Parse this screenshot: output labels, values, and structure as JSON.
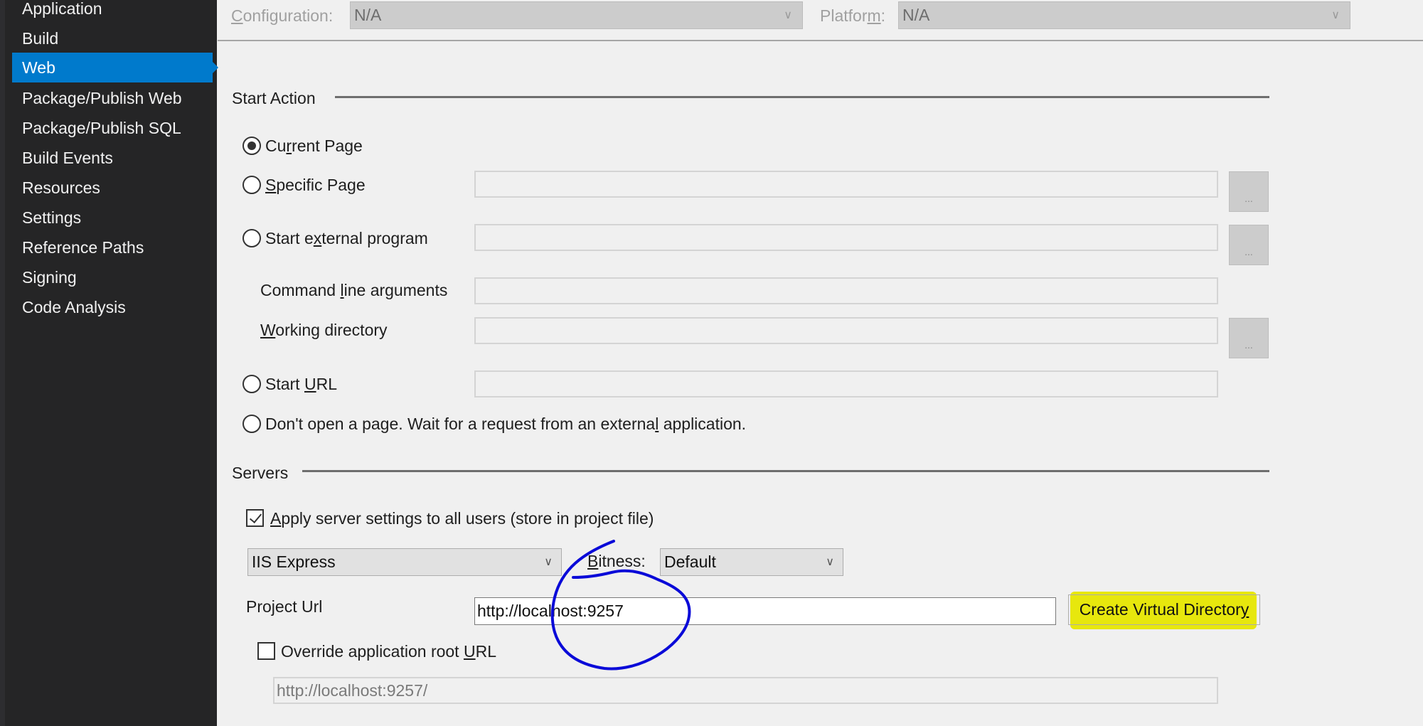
{
  "sidebar": {
    "items": [
      {
        "label": "Application",
        "active": false
      },
      {
        "label": "Build",
        "active": false
      },
      {
        "label": "Web",
        "active": true
      },
      {
        "label": "Package/Publish Web",
        "active": false
      },
      {
        "label": "Package/Publish SQL",
        "active": false
      },
      {
        "label": "Build Events",
        "active": false
      },
      {
        "label": "Resources",
        "active": false
      },
      {
        "label": "Settings",
        "active": false
      },
      {
        "label": "Reference Paths",
        "active": false
      },
      {
        "label": "Signing",
        "active": false
      },
      {
        "label": "Code Analysis",
        "active": false
      }
    ]
  },
  "config_bar": {
    "configuration_label_pre": "",
    "configuration_label_accel": "C",
    "configuration_label_post": "onfiguration:",
    "configuration_value": "N/A",
    "platform_label_pre": "Platfor",
    "platform_label_accel": "m",
    "platform_label_post": ":",
    "platform_value": "N/A"
  },
  "start_action": {
    "title": "Start Action",
    "options": {
      "current_page": {
        "pre": "Cu",
        "accel": "r",
        "post": "rent Page",
        "checked": true
      },
      "specific_page": {
        "pre": "",
        "accel": "S",
        "post": "pecific Page",
        "checked": false,
        "value": ""
      },
      "external_program": {
        "pre": "Start e",
        "accel": "x",
        "post": "ternal program",
        "checked": false,
        "value": ""
      },
      "start_url": {
        "pre": "Start ",
        "accel": "U",
        "post": "RL",
        "checked": false,
        "value": ""
      },
      "dont_open": {
        "pre": "Don't open a page.  Wait for a request from an externa",
        "accel": "l",
        "post": " application.",
        "checked": false
      }
    },
    "command_line_args": {
      "pre": "Command ",
      "accel": "l",
      "post": "ine arguments",
      "value": ""
    },
    "working_directory": {
      "pre": "",
      "accel": "W",
      "post": "orking directory",
      "value": ""
    },
    "browse_label": "..."
  },
  "servers": {
    "title": "Servers",
    "apply_all": {
      "pre": "",
      "accel": "A",
      "post": "pply server settings to all users (store in project file)",
      "checked": true
    },
    "server_value": "IIS Express",
    "bitness_label_pre": "",
    "bitness_label_accel": "B",
    "bitness_label_post": "itness:",
    "bitness_value": "Default",
    "project_url_label": "Project Url",
    "project_url_value": "http://localhost:9257",
    "create_vdir_pre": "Create Virtual Director",
    "create_vdir_accel": "y",
    "create_vdir_post": "",
    "override_root": {
      "pre": "Override application root ",
      "accel": "U",
      "post": "RL",
      "checked": false
    },
    "override_root_value": "http://localhost:9257/"
  },
  "annotations": {
    "circle_color": "#0a0ad8",
    "highlight_color": "#e6e600"
  }
}
